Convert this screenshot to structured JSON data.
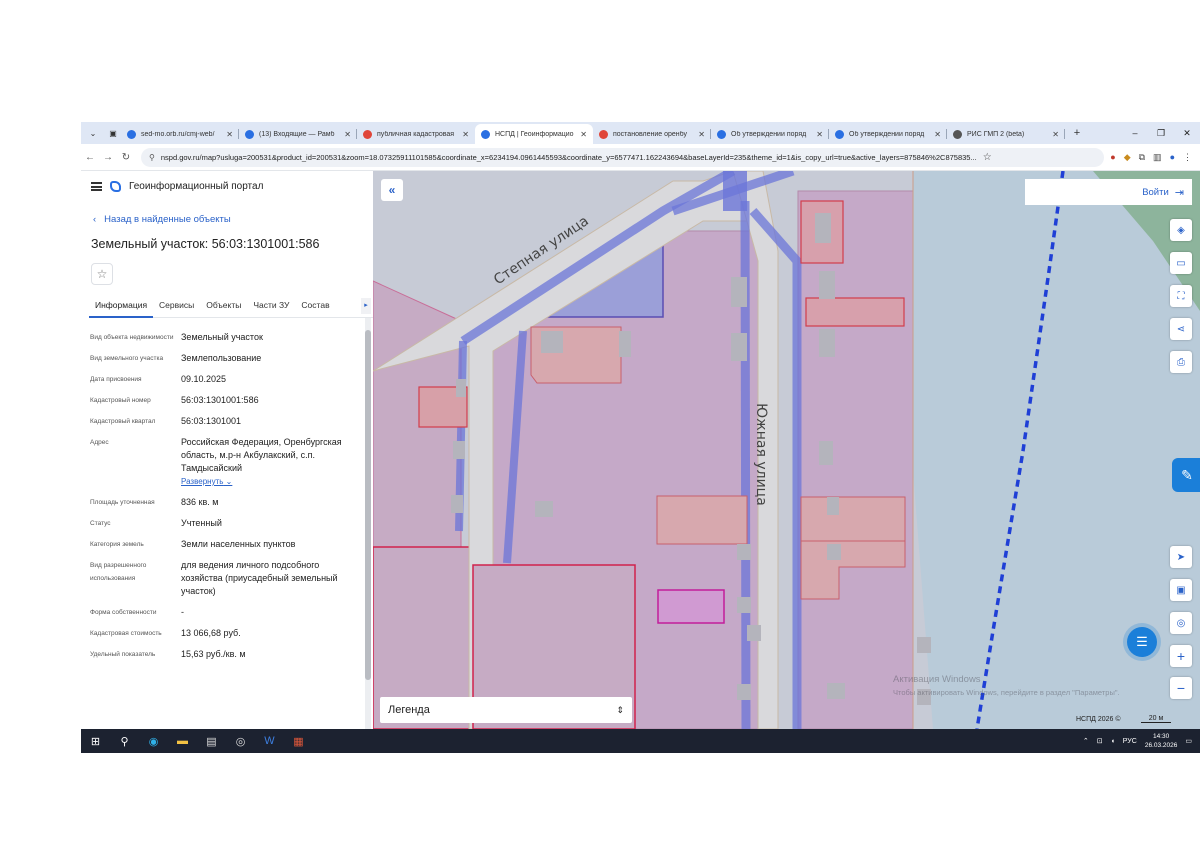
{
  "browser": {
    "tabs": [
      {
        "title": "sed-mo.orb.ru/cmj-web/",
        "color": "#2a6fe2"
      },
      {
        "title": "(13) Входящие — Рамб",
        "color": "#2a6fe2"
      },
      {
        "title": "публичная кадастровая",
        "color": "#e0463a"
      },
      {
        "title": "НСПД | Геоинформацио",
        "color": "#2a6fe2"
      },
      {
        "title": "постановление оренбу",
        "color": "#e0463a"
      },
      {
        "title": "Об утверждении поряд",
        "color": "#2a6fe2"
      },
      {
        "title": "Об утверждении поряд",
        "color": "#2a6fe2"
      },
      {
        "title": "РИС ГМП 2 (beta)",
        "color": "#555555"
      }
    ],
    "url": "nspd.gov.ru/map?usluga=200531&product_id=200531&zoom=18.07325911101585&coordinate_x=6234194.0961445593&coordinate_y=6577471.162243694&baseLayerId=235&theme_id=1&is_copy_url=true&active_layers=875846%2C875835..."
  },
  "panel": {
    "portal_name": "Геоинформационный портал",
    "back_label": "Назад в найденные объекты",
    "title": "Земельный участок: 56:03:1301001:586",
    "tabs": [
      "Информация",
      "Сервисы",
      "Объекты",
      "Части ЗУ",
      "Состав"
    ],
    "props": [
      {
        "k": "Вид объекта недвижимости",
        "v": "Земельный участок"
      },
      {
        "k": "Вид земельного участка",
        "v": "Землепользование"
      },
      {
        "k": "Дата присвоения",
        "v": "09.10.2025"
      },
      {
        "k": "Кадастровый номер",
        "v": "56:03:1301001:586"
      },
      {
        "k": "Кадастровый квартал",
        "v": "56:03:1301001"
      },
      {
        "k": "Адрес",
        "v": "Российская Федерация, Оренбургская область, м.р-н Акбулакский, с.п. Тамдысайский"
      },
      {
        "k": "Площадь уточненная",
        "v": "836 кв. м"
      },
      {
        "k": "Статус",
        "v": "Учтенный"
      },
      {
        "k": "Категория земель",
        "v": "Земли населенных пунктов"
      },
      {
        "k": "Вид разрешенного использования",
        "v": "для ведения личного подсобного хозяйства (приусадебный земельный участок)"
      },
      {
        "k": "Форма собственности",
        "v": "-"
      },
      {
        "k": "Кадастровая стоимость",
        "v": "13 066,68 руб."
      },
      {
        "k": "Удельный показатель",
        "v": "15,63 руб./кв. м"
      }
    ],
    "expand_label": "Развернуть"
  },
  "map": {
    "login_label": "Войти",
    "legend_label": "Легенда",
    "street_1": "Степная улица",
    "street_2": "Южная улица",
    "watermark_title": "Активация Windows",
    "watermark_text": "Чтобы активировать Windows, перейдите в раздел \"Параметры\".",
    "attribution": "НСПД 2026 ©",
    "scale": "20 м"
  },
  "taskbar": {
    "lang": "РУС",
    "time": "14:30",
    "date": "26.03.2026"
  }
}
